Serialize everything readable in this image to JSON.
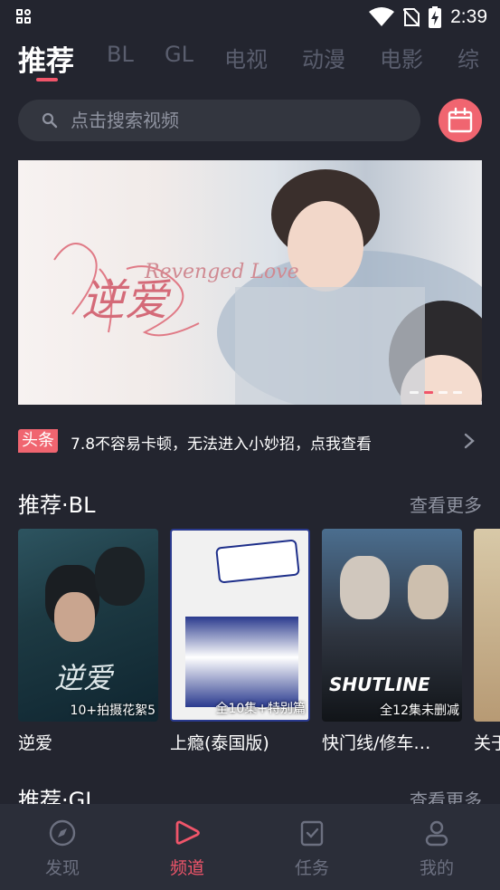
{
  "status_bar": {
    "time": "2:39"
  },
  "tabs": [
    {
      "label": "推荐",
      "active": true
    },
    {
      "label": "BL"
    },
    {
      "label": "GL"
    },
    {
      "label": "电视"
    },
    {
      "label": "动漫"
    },
    {
      "label": "电影"
    },
    {
      "label": "综"
    }
  ],
  "search": {
    "placeholder": "点击搜索视频"
  },
  "banner": {
    "title": "逆爱",
    "subtitle": "Revenged Love"
  },
  "notice": {
    "tag": "头条",
    "text": "7.8不容易卡顿，无法进入小妙招，点我查看"
  },
  "sections": [
    {
      "title": "推荐·BL",
      "more": "查看更多",
      "cards": [
        {
          "title": "逆爱",
          "tag": "10+拍摄花絮5"
        },
        {
          "title": "上瘾(泰国版)",
          "tag": "全10集+特别篇"
        },
        {
          "title": "快门线/修车…",
          "tag": "全12集未删减"
        },
        {
          "title": "关于",
          "tag": ""
        }
      ]
    },
    {
      "title": "推荐·GL",
      "more": "查看更多"
    }
  ],
  "bottom_nav": [
    {
      "label": "发现",
      "icon": "compass-icon"
    },
    {
      "label": "频道",
      "icon": "play-icon",
      "active": true
    },
    {
      "label": "任务",
      "icon": "task-check-icon"
    },
    {
      "label": "我的",
      "icon": "user-icon"
    }
  ],
  "colors": {
    "background": "#23252f",
    "accent": "#f0556a",
    "calendar": "#f06570",
    "muted": "#8f93a0",
    "nav_bg": "#2b2e39"
  }
}
